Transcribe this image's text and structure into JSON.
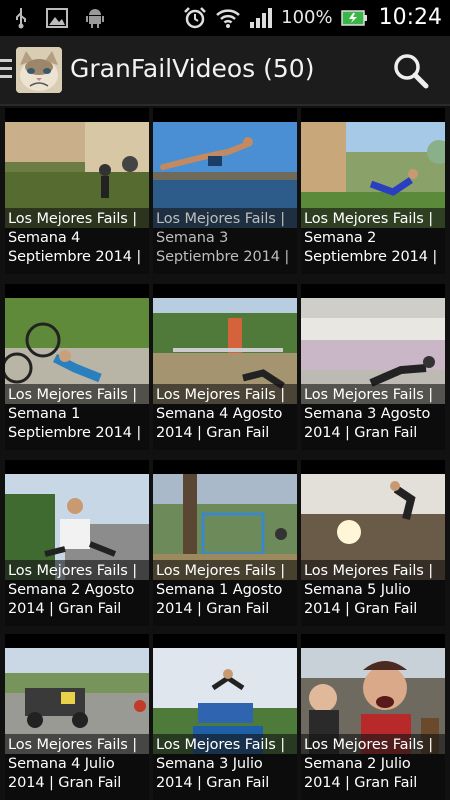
{
  "status_bar": {
    "battery_percent": "100%",
    "time": "10:24",
    "icons": [
      "usb-icon",
      "image-icon",
      "android-icon",
      "alarm-icon",
      "wifi-icon",
      "signal-icon",
      "battery-icon"
    ]
  },
  "action_bar": {
    "title": "GranFailVideos (50)",
    "icons": [
      "menu-lines-icon",
      "grumpy-cat-app-icon",
      "search-icon"
    ]
  },
  "videos": [
    {
      "line1": "Los Mejores Fails |",
      "line2": "Semana 4",
      "line3": "Septiembre 2014 |"
    },
    {
      "line1": "Los Mejores Fails |",
      "line2": "Semana 3",
      "line3": "Septiembre 2014 |"
    },
    {
      "line1": "Los Mejores Fails |",
      "line2": "Semana 2",
      "line3": "Septiembre 2014 |"
    },
    {
      "line1": "Los Mejores Fails |",
      "line2": "Semana 1",
      "line3": "Septiembre 2014 |"
    },
    {
      "line1": "Los Mejores Fails |",
      "line2": "Semana 4 Agosto",
      "line3": "2014 | Gran Fail"
    },
    {
      "line1": "Los Mejores Fails |",
      "line2": "Semana 3 Agosto",
      "line3": "2014 | Gran Fail"
    },
    {
      "line1": "Los Mejores Fails |",
      "line2": "Semana 2 Agosto",
      "line3": "2014 | Gran Fail"
    },
    {
      "line1": "Los Mejores Fails |",
      "line2": "Semana 1 Agosto",
      "line3": "2014 | Gran Fail"
    },
    {
      "line1": "Los Mejores Fails |",
      "line2": "Semana 5 Julio",
      "line3": "2014 | Gran Fail"
    },
    {
      "line1": "Los Mejores Fails |",
      "line2": "Semana 4 Julio",
      "line3": "2014 | Gran Fail"
    },
    {
      "line1": "Los Mejores Fails |",
      "line2": "Semana 3 Julio",
      "line3": "2014 | Gran Fail"
    },
    {
      "line1": "Los Mejores Fails |",
      "line2": "Semana 2 Julio",
      "line3": "2014 | Gran Fail"
    }
  ],
  "colors": {
    "background": "#111111",
    "action_bar": "#1c1c1c",
    "status_bar": "#000000",
    "battery_green": "#39b54a"
  }
}
